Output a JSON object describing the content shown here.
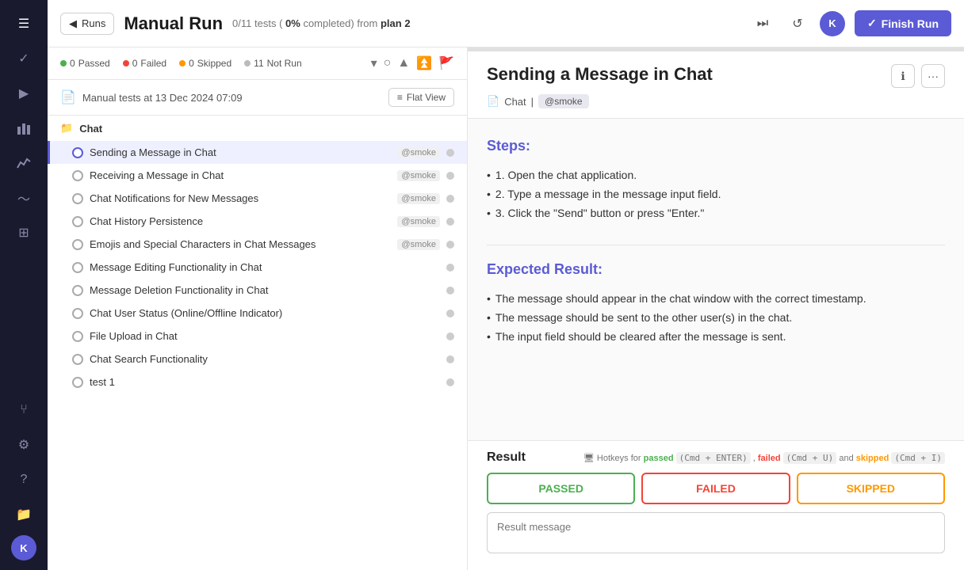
{
  "app": {
    "nav_icons": [
      {
        "name": "hamburger-icon",
        "symbol": "☰",
        "active": true
      },
      {
        "name": "check-icon",
        "symbol": "✓"
      },
      {
        "name": "play-icon",
        "symbol": "▶"
      },
      {
        "name": "chart-icon",
        "symbol": "📊"
      },
      {
        "name": "graph-icon",
        "symbol": "📈"
      },
      {
        "name": "wave-icon",
        "symbol": "〜"
      },
      {
        "name": "grid-icon",
        "symbol": "⊞"
      },
      {
        "name": "branch-icon",
        "symbol": "⑂"
      },
      {
        "name": "settings-icon",
        "symbol": "⚙"
      },
      {
        "name": "help-icon",
        "symbol": "?"
      },
      {
        "name": "folder-icon",
        "symbol": "📁"
      }
    ],
    "nav_avatar": "K"
  },
  "topbar": {
    "runs_button": "Runs",
    "title": "Manual Run",
    "subtitle_tests": "0/11",
    "subtitle_pct": "0%",
    "subtitle_completed": "completed) from",
    "subtitle_plan": "plan 2",
    "finish_run_label": "Finish Run",
    "avatar": "K"
  },
  "status_bar": {
    "passed": {
      "count": "0",
      "label": "Passed"
    },
    "failed": {
      "count": "0",
      "label": "Failed"
    },
    "skipped": {
      "count": "0",
      "label": "Skipped"
    },
    "not_run": {
      "count": "11",
      "label": "Not Run"
    }
  },
  "test_list": {
    "header_label": "Manual tests at 13 Dec 2024 07:09",
    "flat_view_btn": "Flat View",
    "section_label": "Chat",
    "tests": [
      {
        "name": "Sending a Message in Chat",
        "tag": "@smoke",
        "active": true
      },
      {
        "name": "Receiving a Message in Chat",
        "tag": "@smoke",
        "active": false
      },
      {
        "name": "Chat Notifications for New Messages",
        "tag": "@smoke",
        "active": false
      },
      {
        "name": "Chat History Persistence",
        "tag": "@smoke",
        "active": false
      },
      {
        "name": "Emojis and Special Characters in Chat Messages",
        "tag": "@smoke",
        "active": false
      },
      {
        "name": "Message Editing Functionality in Chat",
        "tag": "",
        "active": false
      },
      {
        "name": "Message Deletion Functionality in Chat",
        "tag": "",
        "active": false
      },
      {
        "name": "Chat User Status (Online/Offline Indicator)",
        "tag": "",
        "active": false
      },
      {
        "name": "File Upload in Chat",
        "tag": "",
        "active": false
      },
      {
        "name": "Chat Search Functionality",
        "tag": "",
        "active": false
      },
      {
        "name": "test 1",
        "tag": "",
        "active": false
      }
    ]
  },
  "test_detail": {
    "title": "Sending a Message in Chat",
    "breadcrumb_chat": "Chat",
    "breadcrumb_tag": "@smoke",
    "steps_title": "Steps:",
    "steps": [
      "1. Open the chat application.",
      "2. Type a message in the message input field.",
      "3. Click the \"Send\" button or press \"Enter.\""
    ],
    "expected_title": "Expected Result:",
    "expected": [
      "The message should appear in the chat window with the correct timestamp.",
      "The message should be sent to the other user(s) in the chat.",
      "The input field should be cleared after the message is sent."
    ]
  },
  "result": {
    "title": "Result",
    "hotkeys_prefix": "Hotkeys for",
    "hotkeys_passed": "passed",
    "hotkeys_passed_key": "(Cmd + ENTER)",
    "hotkeys_failed": "failed",
    "hotkeys_failed_key": "(Cmd + U)",
    "hotkeys_skipped": "skipped",
    "hotkeys_skipped_key": "(Cmd + I)",
    "passed_label": "PASSED",
    "failed_label": "FAILED",
    "skipped_label": "SKIPPED",
    "message_placeholder": "Result message"
  }
}
